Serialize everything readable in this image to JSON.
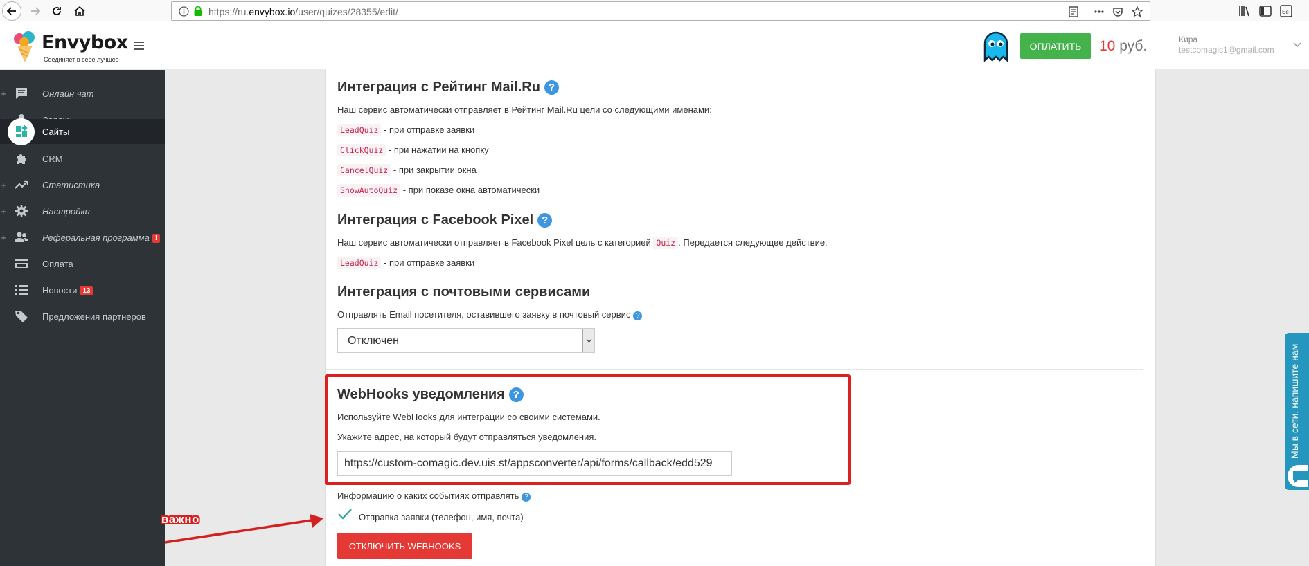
{
  "browser": {
    "url_prefix": "https://ru.",
    "url_domain": "envybox.io",
    "url_path": "/user/quizes/28355/edit/"
  },
  "header": {
    "logo_name": "Envybox",
    "logo_tagline": "Соединяет в себе лучшее",
    "pay_label": "ОПЛАТИТЬ",
    "balance_amount": "10",
    "balance_currency": "руб.",
    "user_name": "Кира",
    "user_email": "testcomagic1@gmail.com"
  },
  "sidebar": {
    "items": [
      {
        "label": "Онлайн чат",
        "icon": "chat-icon"
      },
      {
        "label": "Заявки",
        "icon": "user-icon"
      },
      {
        "label": "Сайты",
        "icon": "sites-icon"
      },
      {
        "label": "CRM",
        "icon": "puzzle-icon"
      },
      {
        "label": "Статистика",
        "icon": "trending-icon"
      },
      {
        "label": "Настройки",
        "icon": "gear-icon"
      },
      {
        "label": "Реферальная программа",
        "icon": "people-icon",
        "badge": "!"
      },
      {
        "label": "Оплата",
        "icon": "card-icon"
      },
      {
        "label": "Новости",
        "icon": "list-icon",
        "badge": "13"
      },
      {
        "label": "Предложения партнеров",
        "icon": "tag-icon"
      }
    ]
  },
  "mailru": {
    "title": "Интеграция с Рейтинг Mail.Ru",
    "intro": "Наш сервис автоматически отправляет в Рейтинг Mail.Ru цели со следующими именами:",
    "goals": [
      {
        "code": "LeadQuiz",
        "desc": "- при отправке заявки"
      },
      {
        "code": "ClickQuiz",
        "desc": "- при нажатии на кнопку"
      },
      {
        "code": "CancelQuiz",
        "desc": "- при закрытии окна"
      },
      {
        "code": "ShowAutoQuiz",
        "desc": "- при показе окна автоматически"
      }
    ]
  },
  "facebook": {
    "title": "Интеграция с Facebook Pixel",
    "intro_before": "Наш сервис автоматически отправляет в Facebook Pixel цель с категорией",
    "category": "Quiz",
    "intro_after": ". Передается следующее действие:",
    "action_code": "LeadQuiz",
    "action_desc": "- при отправке заявки"
  },
  "mail_services": {
    "title": "Интеграция с почтовыми сервисами",
    "description": "Отправлять Email посетителя, оставившего заявку в почтовый сервис",
    "selected": "Отключен"
  },
  "webhooks": {
    "title": "WebHooks уведомления",
    "desc1": "Используйте WebHooks для интеграции со своими системами.",
    "desc2": "Укажите адрес, на который будут отправляться уведомления.",
    "url_value": "https://custom-comagic.dev.uis.st/appsconverter/api/forms/callback/edd529",
    "events_label": "Информацию о каких событиях отправлять",
    "event_label": "Отправка заявки (телефон, имя, почта)",
    "event_checked": true,
    "disable_label": "ОТКЛЮЧИТЬ WEBHOOKS"
  },
  "annotation": {
    "label": "важно"
  },
  "chat_widget": {
    "text": "Мы в сети, напишите нам"
  },
  "colors": {
    "accent_green": "#45b34b",
    "accent_red": "#e53935",
    "help_blue": "#3c97e0",
    "sidebar_bg": "#2e3338"
  }
}
